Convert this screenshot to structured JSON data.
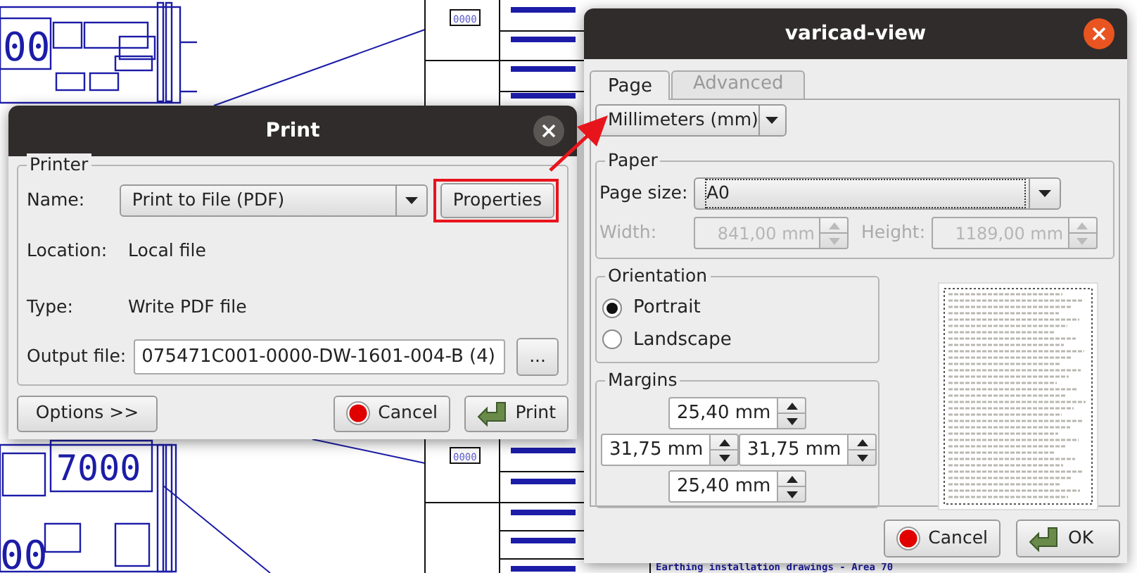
{
  "background": {
    "drawing_labels": [
      "00",
      "7000",
      "00"
    ],
    "tag_labels": [
      "0000",
      "0000"
    ],
    "caption": "Earthing installation drawings - Area 70"
  },
  "print_dialog": {
    "title": "Print",
    "printer_group": "Printer",
    "name_label": "Name:",
    "name_value": "Print to File (PDF)",
    "properties_button": "Properties",
    "properties_highlighted": true,
    "location_label": "Location:",
    "location_value": "Local file",
    "type_label": "Type:",
    "type_value": "Write PDF file",
    "output_label": "Output file:",
    "output_value": "075471C001-0000-DW-1601-004-B (4)",
    "browse_button": "...",
    "options_button": "Options >>",
    "cancel_button": "Cancel",
    "print_button": "Print"
  },
  "annotation_arrow": true,
  "properties_dialog": {
    "title": "varicad-view",
    "tabs": [
      {
        "label": "Page",
        "selected": true
      },
      {
        "label": "Advanced",
        "selected": false
      }
    ],
    "units": "Millimeters (mm)",
    "paper_group": "Paper",
    "page_size_label": "Page size:",
    "page_size": "A0",
    "width_label": "Width:",
    "width": "841,00 mm",
    "height_label": "Height:",
    "height": "1189,00 mm",
    "size_disabled": true,
    "orientation_group": "Orientation",
    "orientations": [
      {
        "label": "Portrait",
        "selected": true
      },
      {
        "label": "Landscape",
        "selected": false
      }
    ],
    "margins_group": "Margins",
    "margins": {
      "top": "25,40 mm",
      "left": "31,75 mm",
      "right": "31,75 mm",
      "bottom": "25,40 mm"
    },
    "cancel_button": "Cancel",
    "ok_button": "OK"
  }
}
